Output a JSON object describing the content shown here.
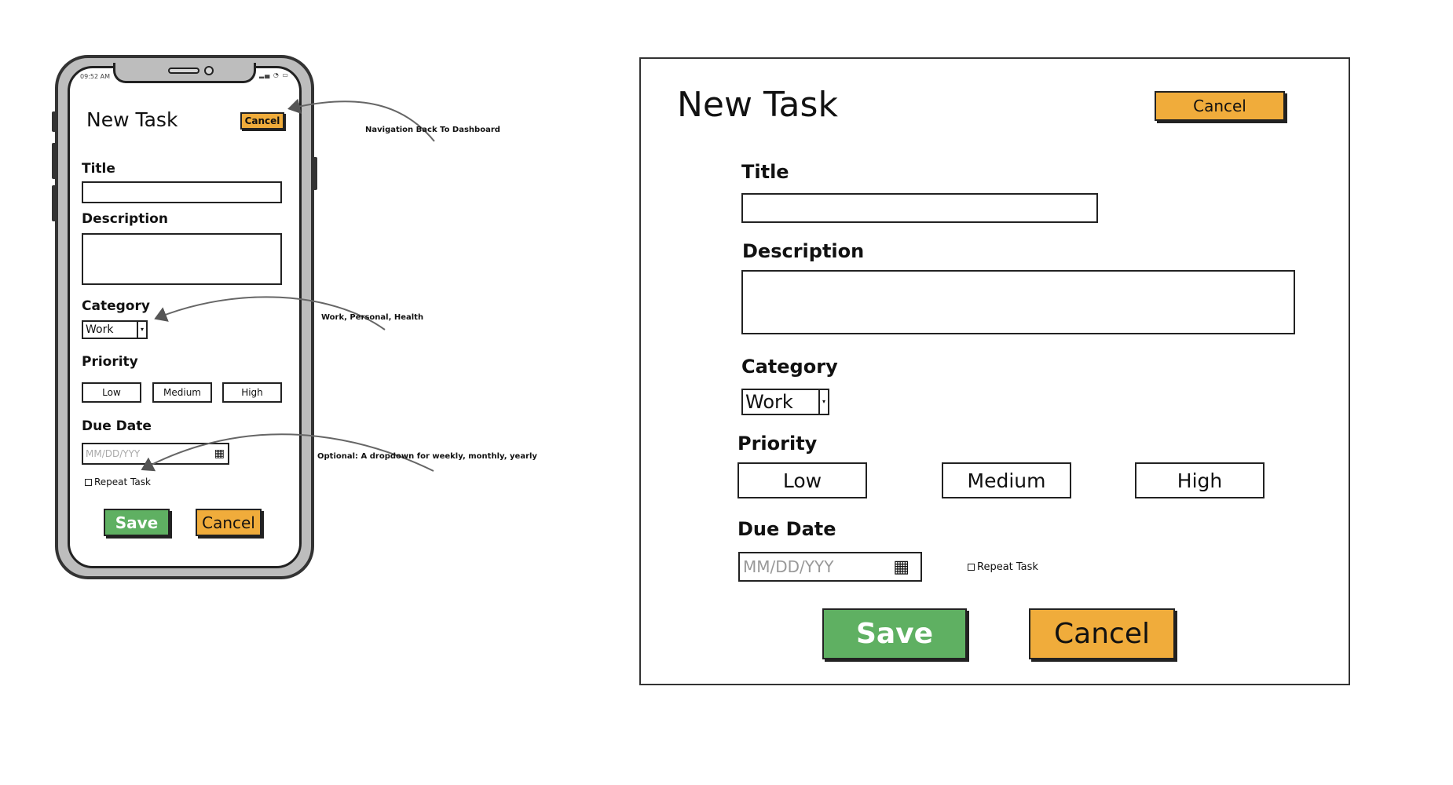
{
  "mobile": {
    "status_time": "09:52 AM",
    "title": "New Task",
    "header_cancel": "Cancel",
    "title_label": "Title",
    "description_label": "Description",
    "category_label": "Category",
    "category_value": "Work",
    "priority_label": "Priority",
    "priority_options": [
      "Low",
      "Medium",
      "High"
    ],
    "due_date_label": "Due Date",
    "due_date_placeholder": "MM/DD/YYY",
    "repeat_label": "Repeat Task",
    "save_label": "Save",
    "cancel_label": "Cancel"
  },
  "annotations": {
    "cancel_note": "Navigation Back To Dashboard",
    "category_note": "Work, Personal, Health",
    "due_date_note": "Optional: A dropdown for weekly, monthly, yearly"
  },
  "desktop": {
    "title": "New Task",
    "header_cancel": "Cancel",
    "title_label": "Title",
    "description_label": "Description",
    "category_label": "Category",
    "category_value": "Work",
    "priority_label": "Priority",
    "priority_options": [
      "Low",
      "Medium",
      "High"
    ],
    "due_date_label": "Due Date",
    "due_date_placeholder": "MM/DD/YYY",
    "repeat_label": "Repeat Task",
    "save_label": "Save",
    "cancel_label": "Cancel"
  },
  "colors": {
    "save_green": "#5fb062",
    "cancel_orange": "#f0ac3b"
  },
  "icons": {
    "calendar": "calendar-icon",
    "dropdown": "chevron-down-icon",
    "checkbox": "checkbox-icon"
  }
}
